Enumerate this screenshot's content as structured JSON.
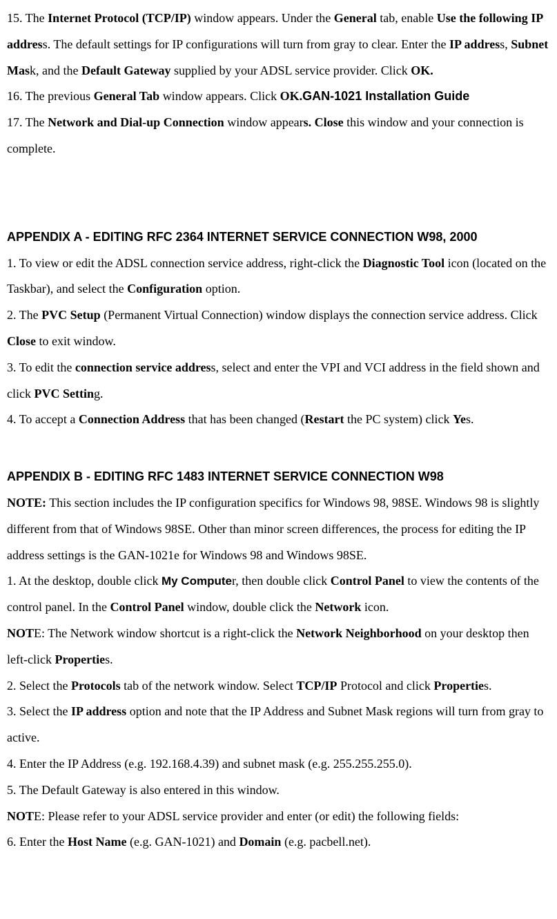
{
  "section1": {
    "p1": {
      "t1": "15. The ",
      "b1": "Internet Protocol (TCP/IP)",
      "t2": " window appears. Under the ",
      "b2": "General",
      "t3": " tab, enable ",
      "b3": "Use the following IP addres",
      "t4": "s. The default settings for IP configurations will turn from gray to clear. Enter the ",
      "b4": "IP addres",
      "t5": "s, ",
      "b5": "Subnet Mas",
      "t6": "k, and the ",
      "b6": "Default Gateway",
      "t7": " supplied by your ADSL service provider. Click ",
      "b7": "OK."
    },
    "p2": {
      "t1": "16. The previous ",
      "b1": "General Tab",
      "t2": " window appears. Click ",
      "b2": "OK.",
      "h1": "GAN-1021 Installation Guide"
    },
    "p3": {
      "t1": "17. The ",
      "b1": "Network and Dial-up Connection",
      "t2": " window appear",
      "b2": "s. Close",
      "t3": " this window and your connection is complete."
    }
  },
  "appendixA": {
    "heading": "APPENDIX A - EDITING RFC 2364 INTERNET SERVICE CONNECTION W98, 2000",
    "p1": {
      "t1": "1. To view or edit the ADSL connection service address, right-click the ",
      "b1": "Diagnostic Tool",
      "t2": " icon (located on the Taskbar), and select the ",
      "b2": "Configuration",
      "t3": " option."
    },
    "p2": {
      "t1": "2. The ",
      "b1": "PVC Setup",
      "t2": " (Permanent Virtual Connection) window displays the connection service address. Click ",
      "b2": "Close",
      "t3": " to exit window."
    },
    "p3": {
      "t1": "3. To edit the ",
      "b1": "connection service addres",
      "t2": "s, select and enter the VPI and VCI address in the field shown and click ",
      "b2": "PVC Settin",
      "t3": "g."
    },
    "p4": {
      "t1": "4. To accept a ",
      "b1": "Connection Address",
      "t2": " that has been changed (",
      "b2": "Restart",
      "t3": " the PC system) click ",
      "b3": "Ye",
      "t4": "s."
    }
  },
  "appendixB": {
    "heading": "APPENDIX B - EDITING RFC 1483 INTERNET SERVICE CONNECTION W98",
    "note1": {
      "b1": "NOTE:",
      "t1": " This section includes the IP configuration specifics for Windows 98, 98SE. Windows 98 is slightly different from that of Windows 98SE. Other than minor screen differences, the process for editing the IP address settings is the GAN-1021e for Windows 98 and Windows 98SE."
    },
    "p1": {
      "t1": "1. At the desktop, double click ",
      "h1": "My Compute",
      "t2": "r, then double click ",
      "b1": "Control Panel",
      "t3": " to view the contents of the control panel. In the ",
      "b2": "Control Panel",
      "t4": " window, double click the ",
      "b3": "Network",
      "t5": " icon."
    },
    "note2": {
      "b1": "NOT",
      "t1": "E: The Network window shortcut is a right-click the ",
      "b2": "Network Neighborhood",
      "t2": " on your desktop then left-click ",
      "b3": "Propertie",
      "t3": "s."
    },
    "p2": {
      "t1": "2. Select the ",
      "b1": "Protocols",
      "t2": " tab of the network window. Select ",
      "b2": "TCP/IP",
      "t3": " Protocol and click ",
      "b3": "Propertie",
      "t4": "s."
    },
    "p3": {
      "t1": "3. Select the ",
      "b1": "IP address",
      "t2": " option and note that the IP Address and Subnet Mask regions will turn from gray to active."
    },
    "p4": {
      "t1": "4. Enter the IP Address (e.g. 192.168.4.39) and subnet mask (e.g. 255.255.255.0)."
    },
    "p5": {
      "t1": "5. The Default Gateway is also entered in this window."
    },
    "note3": {
      "b1": "NOT",
      "t1": "E: Please refer to your ADSL service provider and enter (or edit) the following fields:"
    },
    "p6": {
      "t1": "6. Enter the ",
      "b1": "Host Name",
      "t2": " (e.g. GAN-1021) and ",
      "b2": "Domain",
      "t3": " (e.g. pacbell.net)."
    }
  }
}
